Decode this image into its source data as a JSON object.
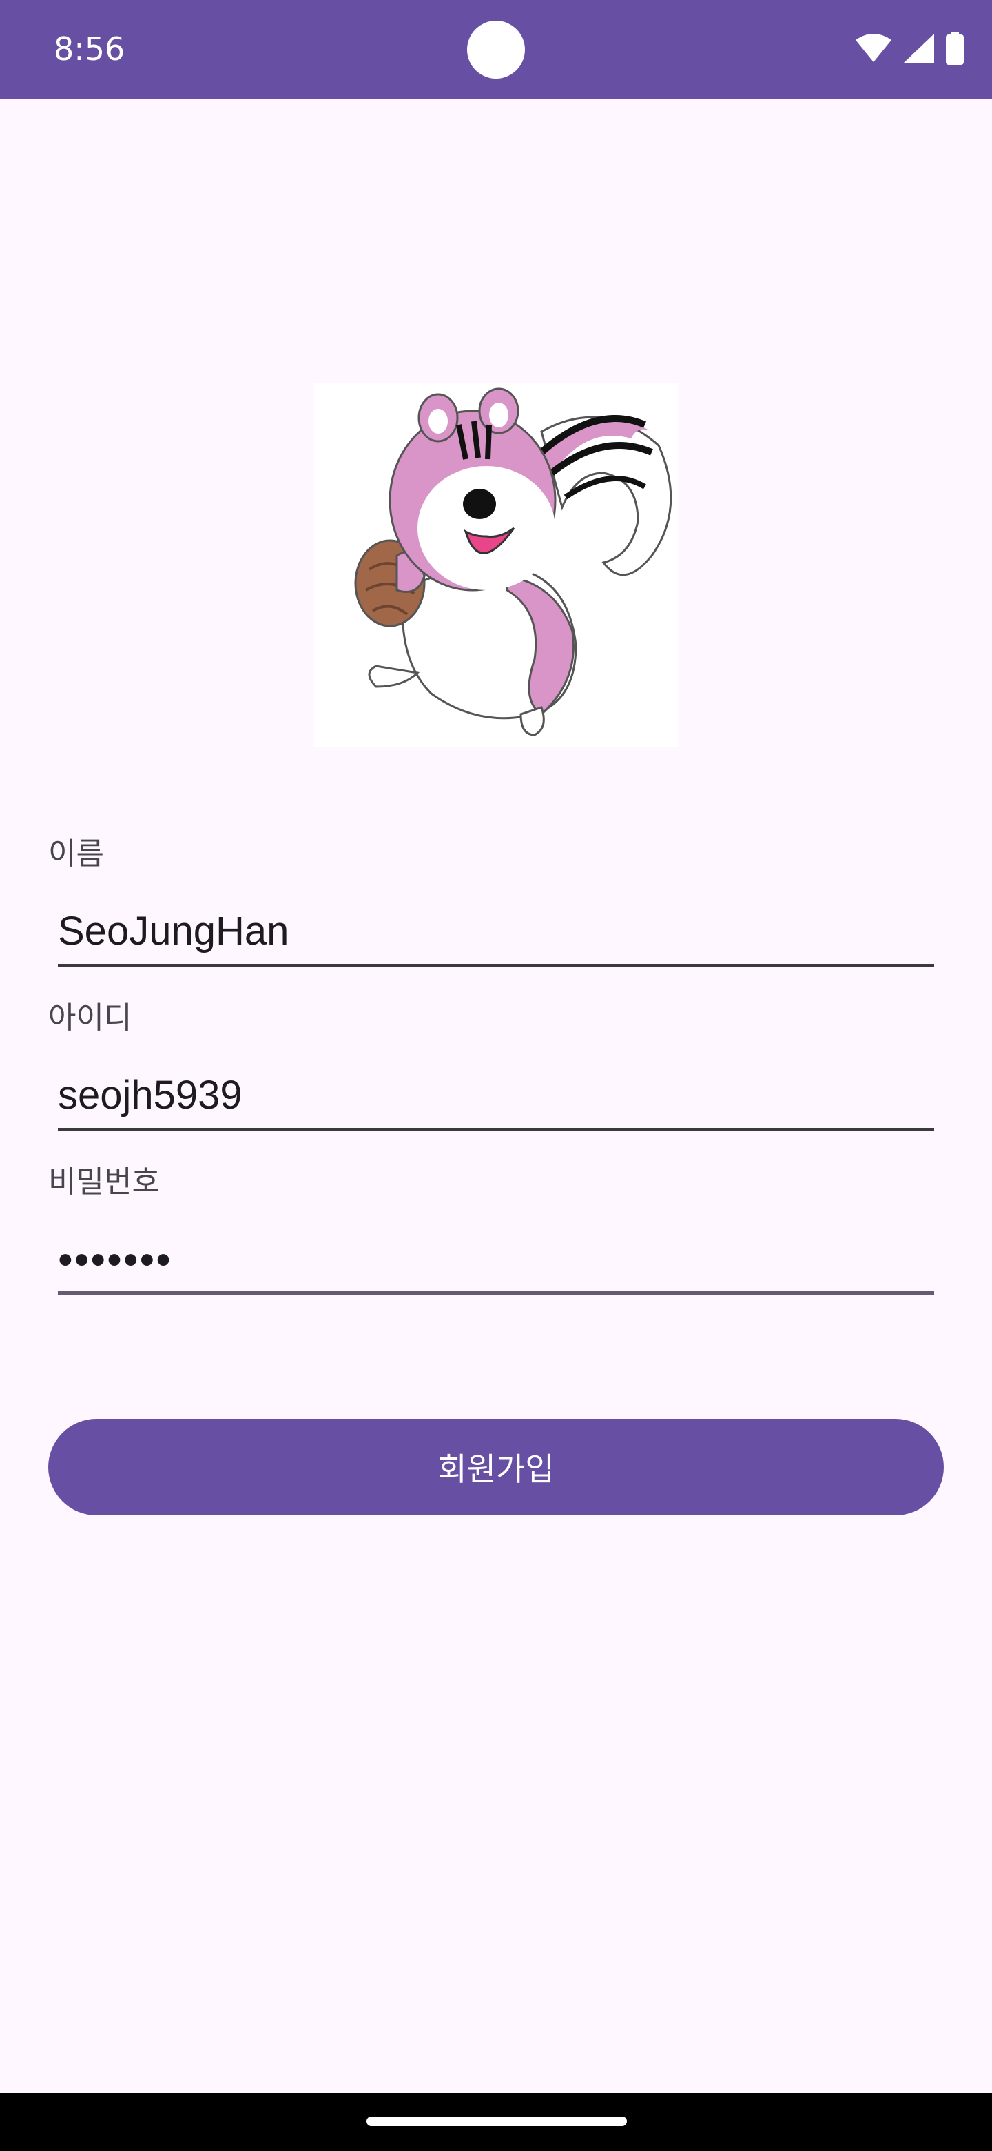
{
  "status_bar": {
    "time": "8:56",
    "icons": [
      "wifi-icon",
      "cellular-signal-icon",
      "battery-icon"
    ],
    "color": "#6750A4"
  },
  "mascot": {
    "icon": "squirrel-mascot-image"
  },
  "form": {
    "name": {
      "label": "이름",
      "value": "SeoJungHan"
    },
    "id": {
      "label": "아이디",
      "value": "seojh5939"
    },
    "password": {
      "label": "비밀번호",
      "value": "•••••••"
    }
  },
  "signup_button": {
    "label": "회원가입",
    "color": "#6750A4"
  },
  "background": "#FEF7FF"
}
